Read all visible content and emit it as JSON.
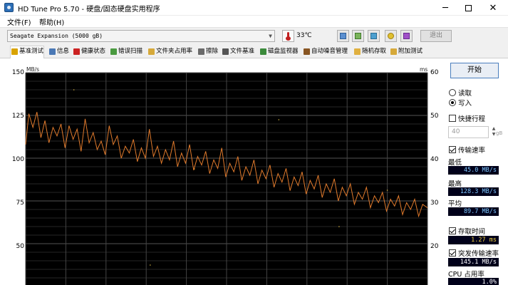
{
  "window": {
    "title": "HD Tune Pro 5.70 - 硬盘/固态硬盘实用程序",
    "min_glyph": "─",
    "close_glyph": "✕"
  },
  "menu": {
    "items": [
      "文件(F)",
      "帮助(H)"
    ]
  },
  "toolbar": {
    "drive": "Seagate Expansion (5000 gB)",
    "temperature": "33℃",
    "exit_label": "退出"
  },
  "tabs": [
    {
      "label": "基准测试",
      "icon_color": "#d9a300"
    },
    {
      "label": "信息",
      "icon_color": "#4a78b5"
    },
    {
      "label": "健康状态",
      "icon_color": "#cc2222"
    },
    {
      "label": "错误扫描",
      "icon_color": "#4a9a40"
    },
    {
      "label": "文件夹占用率",
      "icon_color": "#d6a93a"
    },
    {
      "label": "擦除",
      "icon_color": "#6a6a6a"
    },
    {
      "label": "文件基准",
      "icon_color": "#555555"
    },
    {
      "label": "磁盘监视器",
      "icon_color": "#3b8a3b"
    },
    {
      "label": "自动噪音管理",
      "icon_color": "#885522"
    },
    {
      "label": "随机存取",
      "icon_color": "#e0b040"
    },
    {
      "label": "附加测试",
      "icon_color": "#d6a93a"
    }
  ],
  "chart_data": {
    "type": "line",
    "y_unit_left": "MB/s",
    "y_unit_right": "ms",
    "y_ticks_left": [
      150,
      125,
      100,
      75,
      50
    ],
    "y_ticks_right": [
      60,
      50,
      40,
      30,
      20
    ],
    "ylim_left": [
      25,
      150
    ],
    "ylim_right": [
      10,
      60
    ],
    "grid": true,
    "series": [
      {
        "color": "#e07a2c",
        "x_fraction": [
          0,
          0.008,
          0.018,
          0.028,
          0.038,
          0.048,
          0.058,
          0.068,
          0.078,
          0.088,
          0.098,
          0.108,
          0.118,
          0.128,
          0.138,
          0.148,
          0.158,
          0.168,
          0.178,
          0.188,
          0.198,
          0.208,
          0.218,
          0.228,
          0.238,
          0.248,
          0.258,
          0.268,
          0.278,
          0.288,
          0.298,
          0.308,
          0.318,
          0.328,
          0.338,
          0.348,
          0.358,
          0.368,
          0.378,
          0.388,
          0.398,
          0.408,
          0.418,
          0.428,
          0.438,
          0.448,
          0.458,
          0.468,
          0.478,
          0.488,
          0.498,
          0.508,
          0.518,
          0.528,
          0.538,
          0.548,
          0.558,
          0.568,
          0.578,
          0.588,
          0.598,
          0.608,
          0.618,
          0.628,
          0.638,
          0.648,
          0.658,
          0.668,
          0.678,
          0.688,
          0.698,
          0.708,
          0.718,
          0.728,
          0.738,
          0.748,
          0.758,
          0.768,
          0.778,
          0.788,
          0.798,
          0.808,
          0.818,
          0.828,
          0.838,
          0.848,
          0.858,
          0.868,
          0.878,
          0.888,
          0.898,
          0.908,
          0.918,
          0.928,
          0.938,
          0.948,
          0.958,
          0.968,
          0.978,
          0.988,
          1.0
        ],
        "values": [
          108,
          126,
          118,
          127,
          112,
          122,
          109,
          118,
          113,
          120,
          106,
          119,
          111,
          117,
          104,
          123,
          109,
          115,
          105,
          110,
          102,
          119,
          108,
          113,
          100,
          107,
          103,
          111,
          98,
          106,
          100,
          117,
          101,
          107,
          97,
          105,
          99,
          110,
          95,
          103,
          97,
          108,
          93,
          101,
          96,
          104,
          91,
          99,
          94,
          106,
          89,
          97,
          92,
          101,
          87,
          95,
          90,
          99,
          85,
          93,
          88,
          96,
          83,
          91,
          86,
          94,
          81,
          89,
          84,
          92,
          79,
          87,
          82,
          90,
          77,
          85,
          80,
          88,
          75,
          83,
          78,
          85,
          73,
          80,
          76,
          83,
          71,
          78,
          74,
          80,
          69,
          76,
          72,
          78,
          67,
          74,
          70,
          76,
          66,
          73,
          71
        ]
      }
    ]
  },
  "panel": {
    "start_label": "开始",
    "read_label": "读取",
    "write_label": "写入",
    "quick_label": "快捷行程",
    "quick_value": "40",
    "quick_unit": "gB",
    "transfer_label": "传输速率",
    "min_label": "最低",
    "min_value": "45.0 MB/s",
    "max_label": "最高",
    "max_value": "128.3 MB/s",
    "avg_label": "平均",
    "avg_value": "89.7 MB/s",
    "access_label": "存取时间",
    "access_value": "1.27 ms",
    "burst_label": "突发传输速率",
    "burst_value": "145.1 MB/s",
    "cpu_label": "CPU 占用率",
    "cpu_value": "1.0%"
  }
}
